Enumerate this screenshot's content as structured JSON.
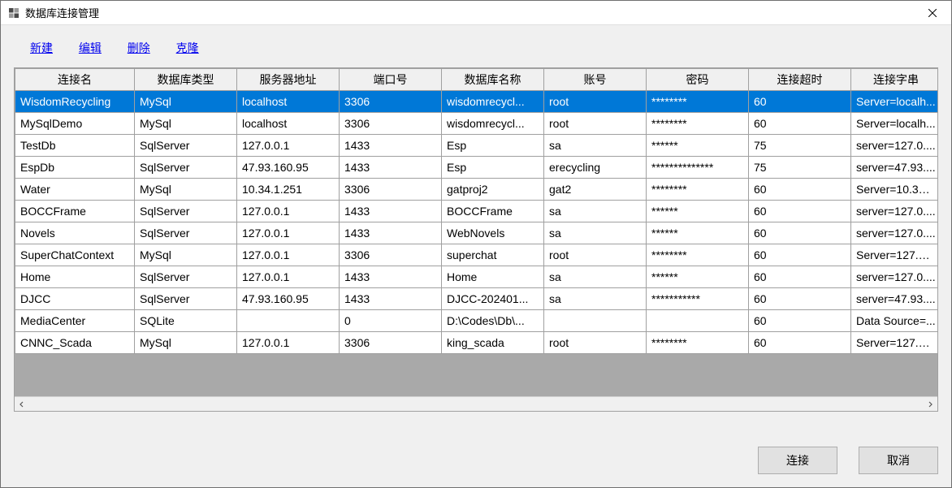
{
  "window": {
    "title": "数据库连接管理"
  },
  "toolbar": {
    "new": "新建",
    "edit": "编辑",
    "delete": "删除",
    "clone": "克隆"
  },
  "columns": {
    "name": "连接名",
    "dbtype": "数据库类型",
    "server": "服务器地址",
    "port": "端口号",
    "dbname": "数据库名称",
    "user": "账号",
    "password": "密码",
    "timeout": "连接超时",
    "connstr": "连接字串"
  },
  "rows": [
    {
      "name": "WisdomRecycling",
      "dbtype": "MySql",
      "server": "localhost",
      "port": "3306",
      "dbname": "wisdomrecycl...",
      "user": "root",
      "password": "********",
      "timeout": "60",
      "connstr": "Server=localh..."
    },
    {
      "name": "MySqlDemo",
      "dbtype": "MySql",
      "server": "localhost",
      "port": "3306",
      "dbname": "wisdomrecycl...",
      "user": "root",
      "password": "********",
      "timeout": "60",
      "connstr": "Server=localh..."
    },
    {
      "name": "TestDb",
      "dbtype": "SqlServer",
      "server": "127.0.0.1",
      "port": "1433",
      "dbname": "Esp",
      "user": "sa",
      "password": "******",
      "timeout": "75",
      "connstr": "server=127.0...."
    },
    {
      "name": "EspDb",
      "dbtype": "SqlServer",
      "server": "47.93.160.95",
      "port": "1433",
      "dbname": "Esp",
      "user": "erecycling",
      "password": "**************",
      "timeout": "75",
      "connstr": "server=47.93...."
    },
    {
      "name": "Water",
      "dbtype": "MySql",
      "server": "10.34.1.251",
      "port": "3306",
      "dbname": "gatproj2",
      "user": "gat2",
      "password": "********",
      "timeout": "60",
      "connstr": "Server=10.34...."
    },
    {
      "name": "BOCCFrame",
      "dbtype": "SqlServer",
      "server": "127.0.0.1",
      "port": "1433",
      "dbname": "BOCCFrame",
      "user": "sa",
      "password": "******",
      "timeout": "60",
      "connstr": "server=127.0...."
    },
    {
      "name": "Novels",
      "dbtype": "SqlServer",
      "server": "127.0.0.1",
      "port": "1433",
      "dbname": "WebNovels",
      "user": "sa",
      "password": "******",
      "timeout": "60",
      "connstr": "server=127.0...."
    },
    {
      "name": "SuperChatContext",
      "dbtype": "MySql",
      "server": "127.0.0.1",
      "port": "3306",
      "dbname": "superchat",
      "user": "root",
      "password": "********",
      "timeout": "60",
      "connstr": "Server=127.0...."
    },
    {
      "name": "Home",
      "dbtype": "SqlServer",
      "server": "127.0.0.1",
      "port": "1433",
      "dbname": "Home",
      "user": "sa",
      "password": "******",
      "timeout": "60",
      "connstr": "server=127.0...."
    },
    {
      "name": "DJCC",
      "dbtype": "SqlServer",
      "server": "47.93.160.95",
      "port": "1433",
      "dbname": "DJCC-202401...",
      "user": "sa",
      "password": "***********",
      "timeout": "60",
      "connstr": "server=47.93...."
    },
    {
      "name": "MediaCenter",
      "dbtype": "SQLite",
      "server": "",
      "port": "0",
      "dbname": "D:\\Codes\\Db\\...",
      "user": "",
      "password": "",
      "timeout": "60",
      "connstr": "Data Source=..."
    },
    {
      "name": "CNNC_Scada",
      "dbtype": "MySql",
      "server": "127.0.0.1",
      "port": "3306",
      "dbname": "king_scada",
      "user": "root",
      "password": "********",
      "timeout": "60",
      "connstr": "Server=127.0...."
    }
  ],
  "selected_index": 0,
  "footer": {
    "connect": "连接",
    "cancel": "取消"
  }
}
